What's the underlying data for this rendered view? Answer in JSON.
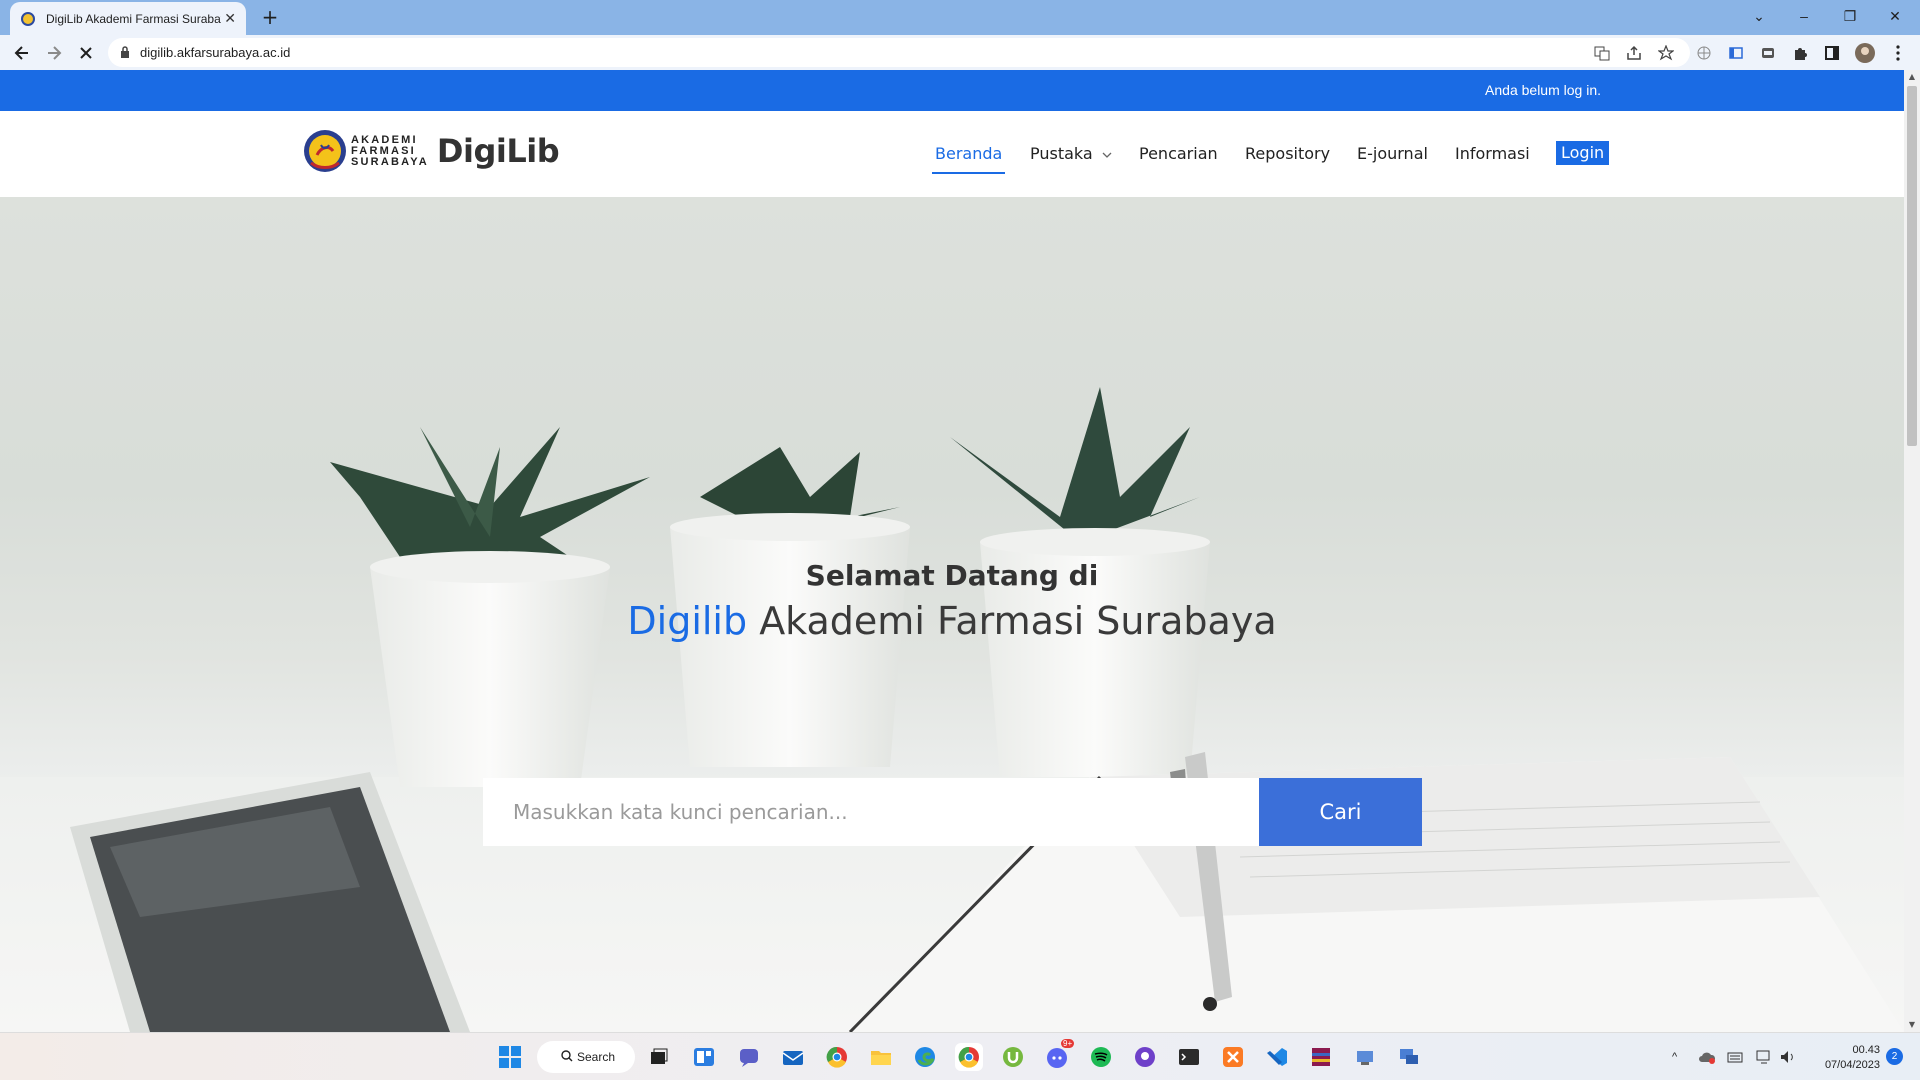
{
  "browser": {
    "tab_title": "DigiLib Akademi Farmasi Surabaya",
    "url": "digilib.akfarsurabaya.ac.id"
  },
  "site": {
    "login_status": "Anda belum log in.",
    "logo_words": [
      "AKADEMI",
      "FARMASI",
      "SURABAYA"
    ],
    "logo_brand": "DigiLib",
    "nav": {
      "beranda": "Beranda",
      "pustaka": "Pustaka",
      "pencarian": "Pencarian",
      "repository": "Repository",
      "ejournal": "E-journal",
      "informasi": "Informasi",
      "login": "Login"
    },
    "hero": {
      "subtitle": "Selamat Datang di",
      "title_accent": "Digilib",
      "title_rest": " Akademi Farmasi Surabaya",
      "search_placeholder": "Masukkan kata kunci pencarian...",
      "search_button": "Cari"
    },
    "colors": {
      "primary": "#1a6be4",
      "search_button": "#3b6fd9"
    }
  },
  "taskbar": {
    "search_label": "Search",
    "clock_time": "00.43",
    "clock_date": "07/04/2023",
    "notification_count": "2",
    "discord_badge": "9+"
  }
}
